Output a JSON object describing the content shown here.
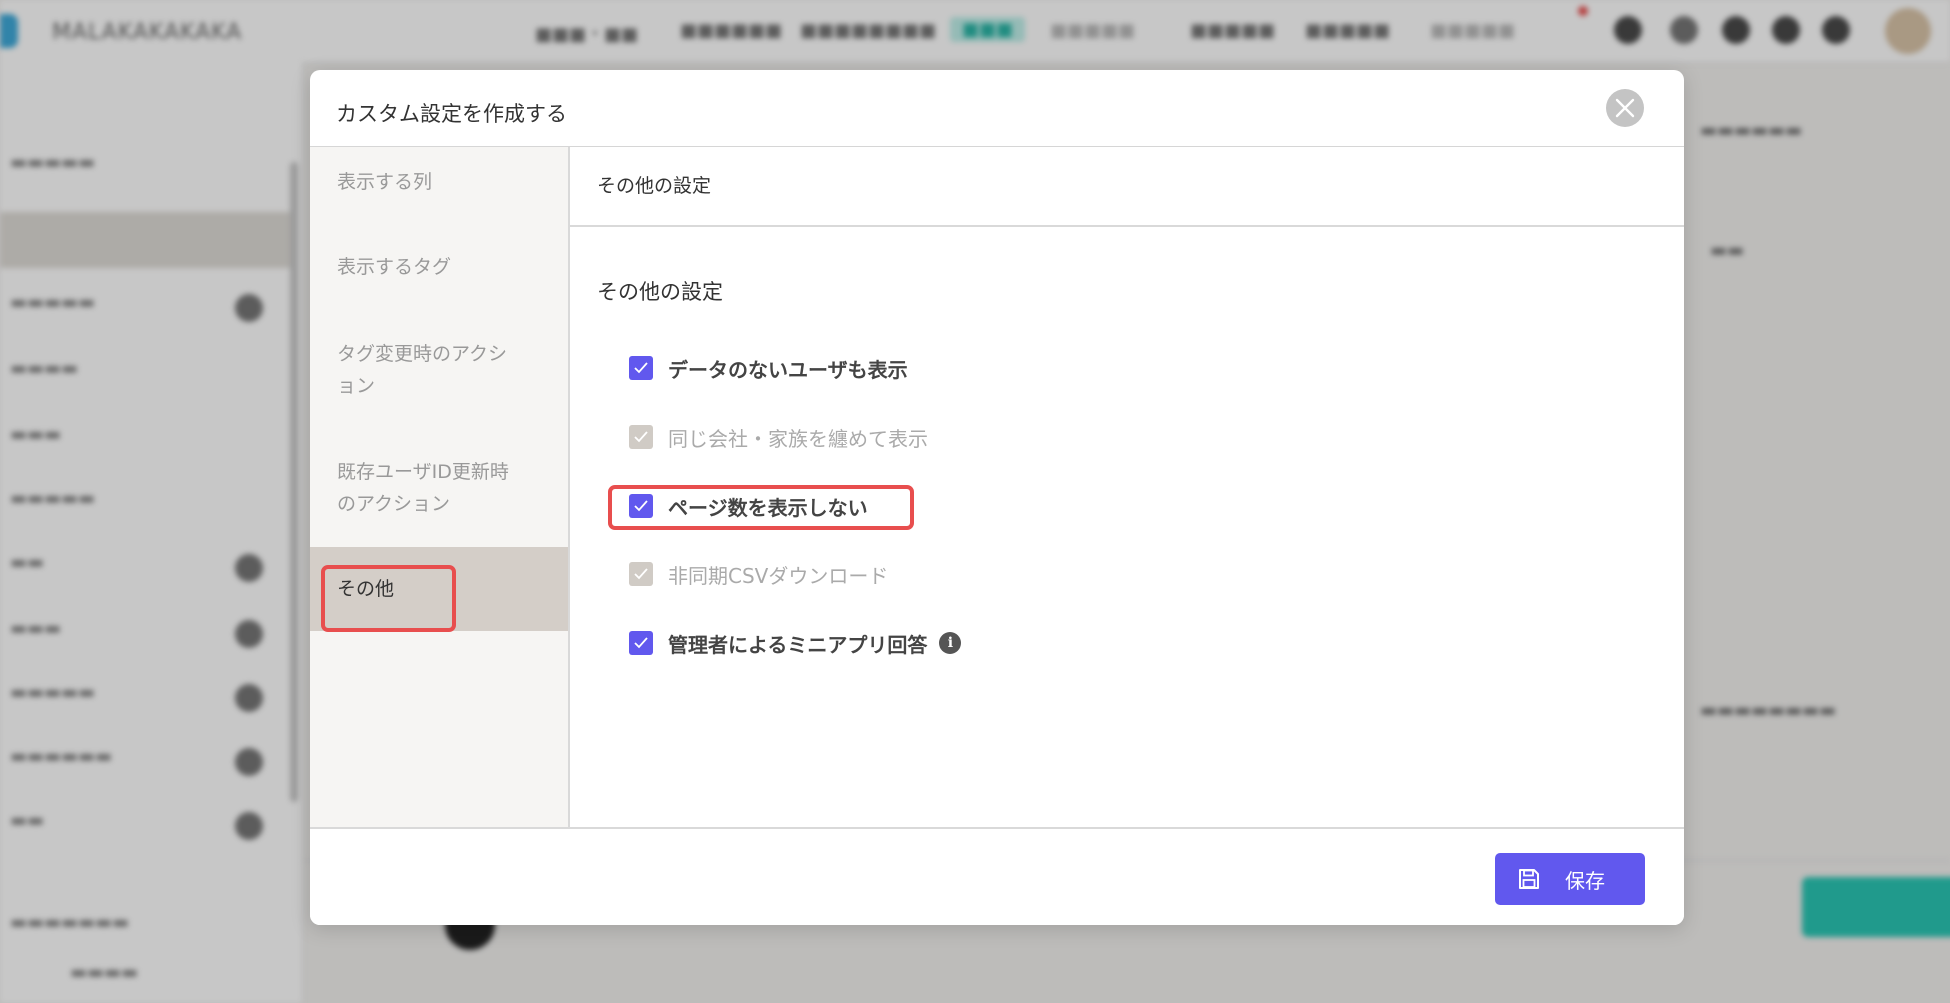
{
  "background": {
    "brand": "MALAKAKAKAKA",
    "nav": [
      "■■■・■■",
      "■■■■■■",
      "■■■■■■■■",
      "■■■",
      "■■■■■",
      "■■■■■",
      "■■■■■",
      "■■■■■"
    ]
  },
  "modal": {
    "title": "カスタム設定を作成する",
    "sidebar": {
      "items": [
        {
          "label": "表示する列"
        },
        {
          "label": "表示するタグ"
        },
        {
          "label": "タグ変更時のアクション"
        },
        {
          "label": "既存ユーザID更新時のアクション"
        },
        {
          "label": "その他"
        }
      ],
      "active_index": 4
    },
    "content": {
      "header_title": "その他の設定",
      "section_title": "その他の設定",
      "options": [
        {
          "label": "データのないユーザも表示",
          "state": "checked"
        },
        {
          "label": "同じ会社・家族を纏めて表示",
          "state": "disabled"
        },
        {
          "label": "ページ数を表示しない",
          "state": "checked"
        },
        {
          "label": "非同期CSVダウンロード",
          "state": "disabled"
        },
        {
          "label": "管理者によるミニアプリ回答",
          "state": "checked",
          "info_icon": "info-icon"
        }
      ]
    },
    "footer": {
      "save_label": "保存",
      "save_icon": "floppy-disk-icon"
    }
  },
  "colors": {
    "accent": "#6158ee",
    "highlight": "#e84e4e",
    "sidebar_active": "#d4cec8",
    "checkbox_disabled": "#d0cbc5"
  }
}
